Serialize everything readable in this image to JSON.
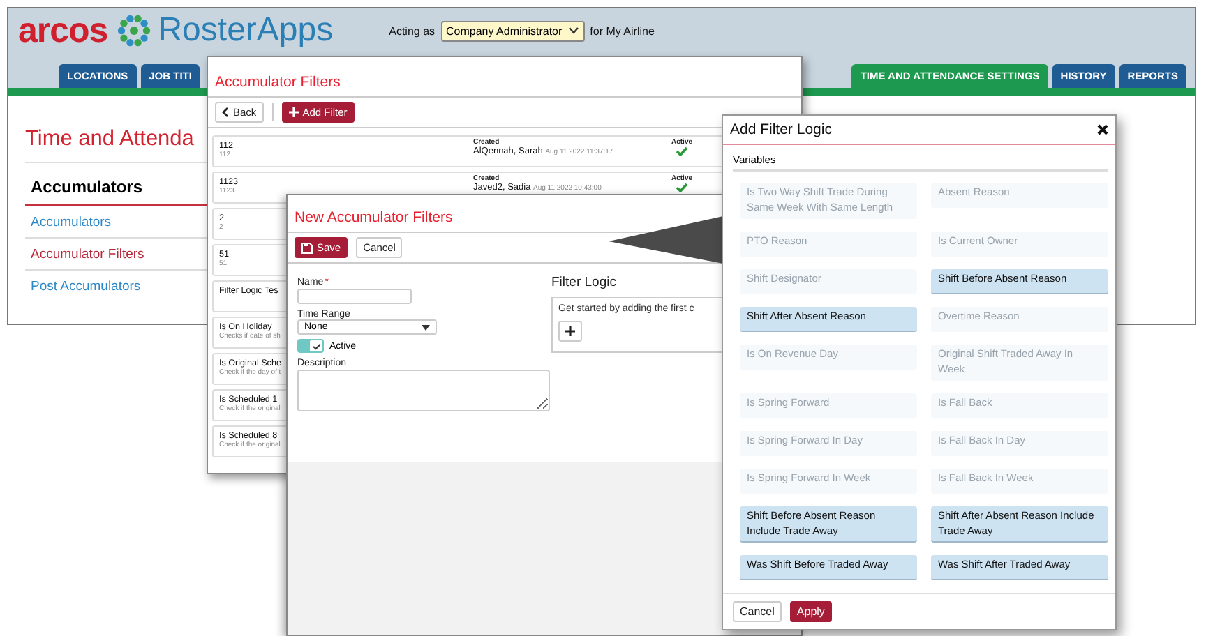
{
  "app": {
    "logo_brand": "arcos",
    "logo_product": "RosterApps",
    "acting_as_label": "Acting as",
    "role": "Company Administrator",
    "for_label": "for My Airline",
    "tabs": [
      {
        "label": "LOCATIONS",
        "selected": false
      },
      {
        "label": "JOB TITI",
        "selected": false
      },
      {
        "label": "TIME AND ATTENDANCE SETTINGS",
        "selected": true
      },
      {
        "label": "HISTORY",
        "selected": false
      },
      {
        "label": "REPORTS",
        "selected": false
      }
    ],
    "page_title": "Time and Attenda",
    "section_title": "Accumulators",
    "nav": [
      {
        "label": "Accumulators",
        "selected": false
      },
      {
        "label": "Accumulator Filters",
        "selected": true
      },
      {
        "label": "Post Accumulators",
        "selected": false
      }
    ]
  },
  "filters_window": {
    "title": "Accumulator Filters",
    "back": "Back",
    "add": "Add Filter",
    "rows": [
      {
        "name": "112",
        "sub": "112",
        "created_label": "Created",
        "creator": "AlQennah, Sarah",
        "timestamp": "Aug 11 2022 11:37:17",
        "status_label": "Active",
        "active": true
      },
      {
        "name": "1123",
        "sub": "1123",
        "created_label": "Created",
        "creator": "Javed2, Sadia",
        "timestamp": "Aug 11 2022 10:43:00",
        "status_label": "Active",
        "active": true
      },
      {
        "name": "2",
        "sub": "2"
      },
      {
        "name": "51",
        "sub": "51"
      },
      {
        "name": "Filter Logic Tes"
      },
      {
        "name": "Is On Holiday",
        "sub": "Checks if date of sh"
      },
      {
        "name": "Is Original Sche",
        "sub": "Check if the day of t"
      },
      {
        "name": "Is Scheduled 1",
        "sub": "Check if the original"
      },
      {
        "name": "Is Scheduled 8",
        "sub": "Check if the original"
      }
    ]
  },
  "new_window": {
    "title": "New Accumulator Filters",
    "save": "Save",
    "cancel": "Cancel",
    "name_label": "Name",
    "required_mark": "*",
    "time_range_label": "Time Range",
    "time_range": "None",
    "active_label": "Active",
    "active": true,
    "description_label": "Description",
    "logic_title": "Filter Logic",
    "logic_hint": "Get started by adding the first c"
  },
  "dialog": {
    "title": "Add Filter Logic",
    "section": "Variables",
    "variables": [
      {
        "label": "Is Two Way Shift Trade During Same Week With Same Length",
        "disabled": true
      },
      {
        "label": "Absent Reason",
        "disabled": true
      },
      {
        "label": "PTO Reason",
        "disabled": true
      },
      {
        "label": "Is Current Owner",
        "disabled": true
      },
      {
        "label": "Shift Designator",
        "disabled": true
      },
      {
        "label": "Shift Before Absent Reason",
        "disabled": false
      },
      {
        "label": "Shift After Absent Reason",
        "disabled": false
      },
      {
        "label": "Overtime Reason",
        "disabled": true
      },
      {
        "label": "Is On Revenue Day",
        "disabled": true
      },
      {
        "label": "Original Shift Traded Away In Week",
        "disabled": true
      },
      {
        "label": "Is Spring Forward",
        "disabled": true
      },
      {
        "label": "Is Fall Back",
        "disabled": true
      },
      {
        "label": "Is Spring Forward In Day",
        "disabled": true
      },
      {
        "label": "Is Fall Back In Day",
        "disabled": true
      },
      {
        "label": "Is Spring Forward In Week",
        "disabled": true
      },
      {
        "label": "Is Fall Back In Week",
        "disabled": true
      },
      {
        "label": "Shift Before Absent Reason Include Trade Away",
        "disabled": false
      },
      {
        "label": "Shift After Absent Reason Include Trade Away",
        "disabled": false
      },
      {
        "label": "Was Shift Before Traded Away",
        "disabled": false
      },
      {
        "label": "Was Shift After Traded Away",
        "disabled": false
      }
    ],
    "cancel": "Cancel",
    "apply": "Apply"
  }
}
